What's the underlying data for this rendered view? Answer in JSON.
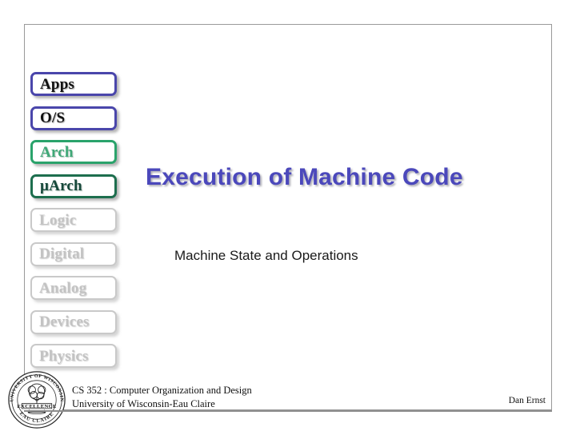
{
  "slide": {
    "title": "Execution of Machine Code",
    "subtitle": "Machine State and Operations",
    "title_color": "#4b48bb"
  },
  "layer_stack": {
    "items": [
      {
        "label": "Apps",
        "style": "v-blue",
        "accent": "#4a46ab",
        "state": "active"
      },
      {
        "label": "O/S",
        "style": "v-blue",
        "accent": "#4a46ab",
        "state": "active"
      },
      {
        "label": "Arch",
        "style": "v-green-light",
        "accent": "#2aa36b",
        "state": "highlighted"
      },
      {
        "label": "µArch",
        "style": "v-green-dark",
        "accent": "#1d6e4e",
        "state": "highlighted"
      },
      {
        "label": "Logic",
        "style": "v-grey",
        "accent": "#c9c9c9",
        "state": "dimmed"
      },
      {
        "label": "Digital",
        "style": "v-grey",
        "accent": "#c9c9c9",
        "state": "dimmed"
      },
      {
        "label": "Analog",
        "style": "v-grey",
        "accent": "#c9c9c9",
        "state": "dimmed"
      },
      {
        "label": "Devices",
        "style": "v-grey",
        "accent": "#c9c9c9",
        "state": "dimmed"
      },
      {
        "label": "Physics",
        "style": "v-grey",
        "accent": "#c9c9c9",
        "state": "dimmed"
      }
    ]
  },
  "footer": {
    "course_line": "CS 352 : Computer Organization and Design",
    "institution_line": "University of Wisconsin-Eau Claire",
    "author": "Dan Ernst",
    "seal": {
      "top_text": "UNIVERSITY OF WISCONSIN",
      "bottom_text": "EAU CLAIRE",
      "banner_text": "EXCELLENCE"
    }
  }
}
